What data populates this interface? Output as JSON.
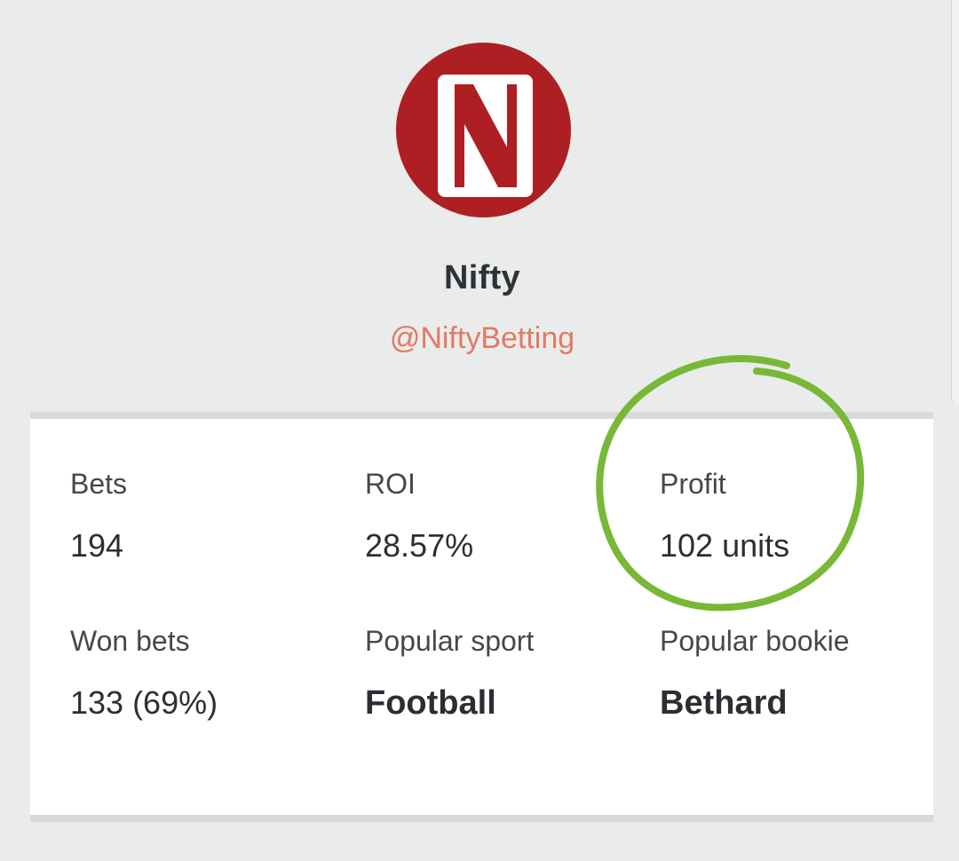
{
  "profile": {
    "avatar_letter": "N",
    "avatar_color": "#ad1f23",
    "name": "Nifty",
    "handle": "@NiftyBetting"
  },
  "stats": {
    "bets": {
      "label": "Bets",
      "value": "194"
    },
    "roi": {
      "label": "ROI",
      "value": "28.57%"
    },
    "profit": {
      "label": "Profit",
      "value": "102 units"
    },
    "won_bets": {
      "label": "Won bets",
      "value": "133 (69%)"
    },
    "popular_sport": {
      "label": "Popular sport",
      "value": "Football"
    },
    "popular_bookie": {
      "label": "Popular bookie",
      "value": "Bethard"
    }
  },
  "annotation": {
    "type": "hand-drawn-circle",
    "target": "profit",
    "color": "#79b836"
  }
}
